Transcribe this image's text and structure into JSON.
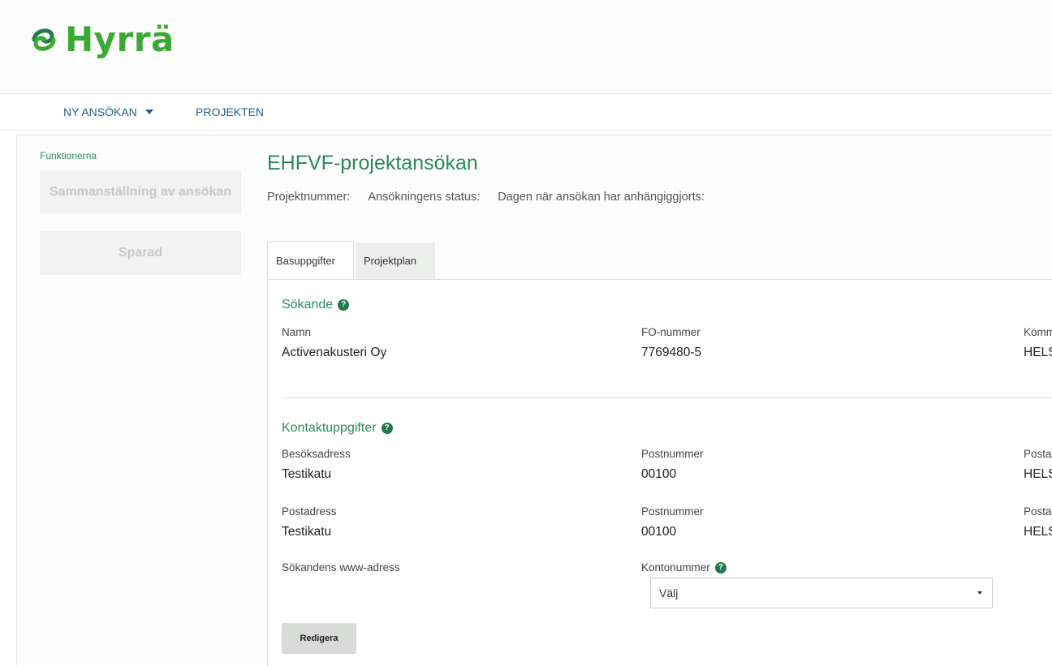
{
  "header": {
    "logo_text": "Hyrrä"
  },
  "nav": {
    "items": [
      {
        "label": "NY ANSÖKAN"
      },
      {
        "label": "PROJEKTEN"
      }
    ]
  },
  "sidebar": {
    "title": "Funktionerna",
    "buttons": [
      {
        "label": "Sammanställning av ansökan"
      },
      {
        "label": "Sparad"
      }
    ]
  },
  "page": {
    "title": "EHFVF-projektansökan",
    "meta": {
      "project_number": "Projektnummer:",
      "status": "Ansökningens status:",
      "date": "Dagen när ansökan har anhängiggjorts:"
    },
    "tabs": [
      {
        "label": "Basuppgifter"
      },
      {
        "label": "Projektplan"
      }
    ]
  },
  "applicant": {
    "section_title": "Sökande",
    "name_label": "Namn",
    "name_value": "Activenakusteri Oy",
    "fo_label": "FO-nummer",
    "fo_value": "7769480-5",
    "municipality_label": "Komm",
    "municipality_value": "HELS"
  },
  "contact": {
    "section_title": "Kontaktuppgifter",
    "visit_address_label": "Besöksadress",
    "visit_address_value": "Testikatu",
    "visit_postal_label": "Postnummer",
    "visit_postal_value": "00100",
    "visit_post_office_label": "Postar",
    "visit_post_office_value": "HELS",
    "postal_address_label": "Postadress",
    "postal_address_value": "Testikatu",
    "postal_postal_label": "Postnummer",
    "postal_postal_value": "00100",
    "postal_post_office_label": "Postar",
    "postal_post_office_value": "HELS",
    "www_label": "Sökandens www-adress",
    "account_label": "Kontonummer",
    "account_select_value": "Välj"
  },
  "actions": {
    "edit_label": "Redigera"
  },
  "colors": {
    "brand_green": "#3aaa35",
    "heading_green": "#2a8a5a",
    "nav_blue": "#1f5f8f"
  }
}
